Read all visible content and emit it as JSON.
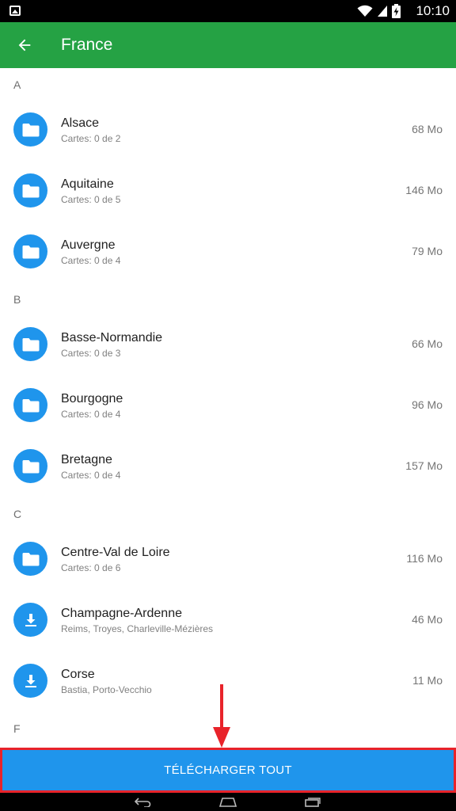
{
  "status_bar": {
    "time": "10:10"
  },
  "app_bar": {
    "title": "France"
  },
  "sections": [
    {
      "letter": "A",
      "items": [
        {
          "name": "Alsace",
          "sub": "Cartes: 0 de 2",
          "size": "68 Mo",
          "icon": "folder-icon"
        },
        {
          "name": "Aquitaine",
          "sub": "Cartes: 0 de 5",
          "size": "146 Mo",
          "icon": "folder-icon"
        },
        {
          "name": "Auvergne",
          "sub": "Cartes: 0 de 4",
          "size": "79 Mo",
          "icon": "folder-icon"
        }
      ]
    },
    {
      "letter": "B",
      "items": [
        {
          "name": "Basse-Normandie",
          "sub": "Cartes: 0 de 3",
          "size": "66 Mo",
          "icon": "folder-icon"
        },
        {
          "name": "Bourgogne",
          "sub": "Cartes: 0 de 4",
          "size": "96 Mo",
          "icon": "folder-icon"
        },
        {
          "name": "Bretagne",
          "sub": "Cartes: 0 de 4",
          "size": "157 Mo",
          "icon": "folder-icon"
        }
      ]
    },
    {
      "letter": "C",
      "items": [
        {
          "name": "Centre-Val de Loire",
          "sub": "Cartes: 0 de 6",
          "size": "116 Mo",
          "icon": "folder-icon"
        },
        {
          "name": "Champagne-Ardenne",
          "sub": "Reims, Troyes, Charleville-Mézières",
          "size": "46 Mo",
          "icon": "download-icon"
        },
        {
          "name": "Corse",
          "sub": "Bastia, Porto-Vecchio",
          "size": "11 Mo",
          "icon": "download-icon"
        }
      ]
    },
    {
      "letter": "F",
      "items": []
    }
  ],
  "download_all_label": "TÉLÉCHARGER TOUT",
  "colors": {
    "app_bar": "#25a244",
    "accent_blue": "#1f95ec",
    "highlight_red": "#e8232a"
  }
}
